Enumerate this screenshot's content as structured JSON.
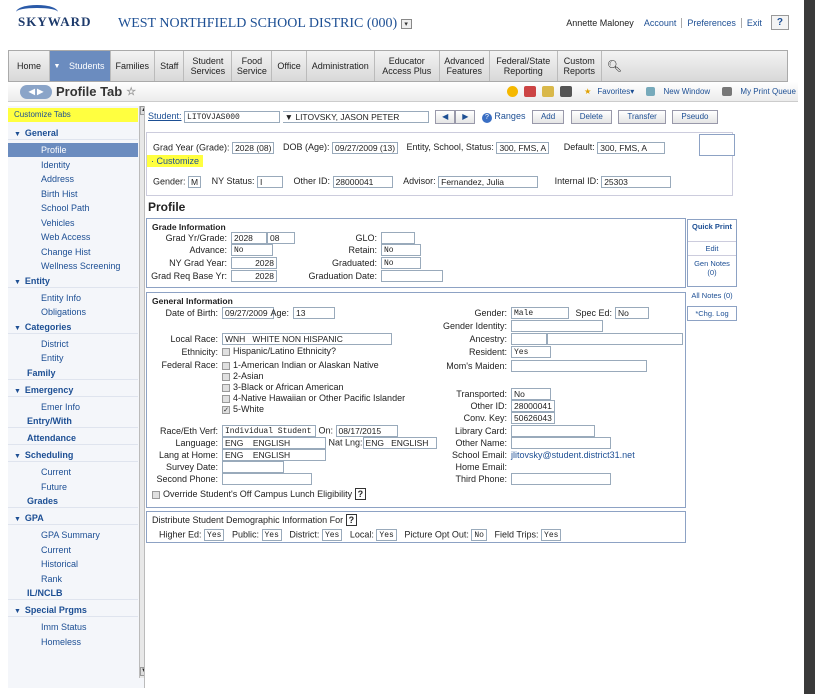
{
  "header": {
    "logo_text": "SKYWARD",
    "district_title": "WEST NORTHFIELD SCHOOL DISTRIC (000)",
    "user_name": "Annette Maloney",
    "links": [
      "Account",
      "Preferences",
      "Exit"
    ],
    "help": "?"
  },
  "nav": {
    "tabs": [
      "Home",
      "Students",
      "Families",
      "Staff",
      "Student Services",
      "Food Service",
      "Office",
      "Administration",
      "Educator Access Plus",
      "Advanced Features",
      "Federal/State Reporting",
      "Custom Reports"
    ]
  },
  "toolbar": {
    "title": "Profile Tab",
    "favorites": "Favorites",
    "new_window": "New Window",
    "print_queue": "My Print Queue"
  },
  "sidebar": {
    "customize_tabs": "Customize Tabs",
    "items": [
      {
        "label": "General",
        "type": "cat",
        "tri": true
      },
      {
        "label": "Profile",
        "type": "sub",
        "active": true
      },
      {
        "label": "Identity",
        "type": "sub"
      },
      {
        "label": "Address",
        "type": "sub"
      },
      {
        "label": "Birth Hist",
        "type": "sub"
      },
      {
        "label": "School Path",
        "type": "sub"
      },
      {
        "label": "Vehicles",
        "type": "sub"
      },
      {
        "label": "Web Access",
        "type": "sub"
      },
      {
        "label": "Change Hist",
        "type": "sub"
      },
      {
        "label": "Wellness Screening",
        "type": "sub"
      },
      {
        "label": "Entity",
        "type": "cat",
        "tri": true
      },
      {
        "label": "Entity Info",
        "type": "sub"
      },
      {
        "label": "Obligations",
        "type": "sub"
      },
      {
        "label": "Categories",
        "type": "cat",
        "tri": true
      },
      {
        "label": "District",
        "type": "sub"
      },
      {
        "label": "Entity",
        "type": "sub"
      },
      {
        "label": "Family",
        "type": "cat"
      },
      {
        "label": "Emergency",
        "type": "cat",
        "tri": true
      },
      {
        "label": "Emer Info",
        "type": "sub"
      },
      {
        "label": "Entry/With",
        "type": "cat"
      },
      {
        "label": "Attendance",
        "type": "cat"
      },
      {
        "label": "Scheduling",
        "type": "cat",
        "tri": true
      },
      {
        "label": "Current",
        "type": "sub"
      },
      {
        "label": "Future",
        "type": "sub"
      },
      {
        "label": "Grades",
        "type": "cat"
      },
      {
        "label": "GPA",
        "type": "cat",
        "tri": true
      },
      {
        "label": "GPA Summary",
        "type": "sub"
      },
      {
        "label": "Current",
        "type": "sub"
      },
      {
        "label": "Historical",
        "type": "sub"
      },
      {
        "label": "Rank",
        "type": "sub"
      },
      {
        "label": "IL/NCLB",
        "type": "cat"
      },
      {
        "label": "Special Prgms",
        "type": "cat",
        "tri": true
      },
      {
        "label": "Imm Status",
        "type": "sub"
      },
      {
        "label": "Homeless",
        "type": "sub"
      }
    ]
  },
  "student_bar": {
    "student_label": "Student:",
    "student_id": "LITOVJAS000",
    "student_name": "LITOVSKY, JASON PETER",
    "ranges": "Ranges",
    "buttons": [
      "Add",
      "Delete",
      "Transfer",
      "Pseudo"
    ]
  },
  "summary": {
    "grad_label": "Grad Year (Grade):",
    "grad_value": "2028 (08)",
    "dob_label": "DOB (Age):",
    "dob_value": "09/27/2009 (13)",
    "entity_label": "Entity, School, Status:",
    "entity_value": "300, FMS, A",
    "default_label": "Default:",
    "default_value": "300, FMS, A",
    "customize": "Customize",
    "gender_label": "Gender:",
    "gender_value": "M",
    "nystatus_label": "NY Status:",
    "nystatus_value": "I",
    "otherid_label": "Other ID:",
    "otherid_value": "28000041",
    "advisor_label": "Advisor:",
    "advisor_value": "Fernandez, Julia",
    "internalid_label": "Internal ID:",
    "internalid_value": "25303"
  },
  "profile": {
    "heading": "Profile",
    "grade_info": {
      "title": "Grade Information",
      "grad_yr_label": "Grad Yr/Grade:",
      "grad_yr": "2028",
      "grade": "08",
      "glo_label": "GLO:",
      "advance_label": "Advance:",
      "advance": "No",
      "retain_label": "Retain:",
      "retain": "No",
      "ny_grad_label": "NY Grad Year:",
      "ny_grad": "2028",
      "graduated_label": "Graduated:",
      "graduated": "No",
      "grad_req_label": "Grad Req Base Yr:",
      "grad_req": "2028",
      "grad_date_label": "Graduation Date:"
    },
    "general_info": {
      "title": "General Information",
      "dob_label": "Date of Birth:",
      "dob": "09/27/2009",
      "age_label": "Age:",
      "age": "13",
      "gender_label": "Gender:",
      "gender": "Male",
      "spec_ed_label": "Spec Ed:",
      "spec_ed": "No",
      "gender_identity_label": "Gender Identity:",
      "local_race_label": "Local Race:",
      "local_race_code": "WNH",
      "local_race_desc": "WHITE NON HISPANIC",
      "ancestry_label": "Ancestry:",
      "ethnicity_label": "Ethnicity:",
      "ethnicity_option": "Hispanic/Latino Ethnicity?",
      "resident_label": "Resident:",
      "resident": "Yes",
      "federal_race_label": "Federal Race:",
      "federal_races": [
        "1-American Indian or Alaskan Native",
        "2-Asian",
        "3-Black or African American",
        "4-Native Hawaiian or Other Pacific Islander",
        "5-White"
      ],
      "moms_maiden_label": "Mom's Maiden:",
      "transported_label": "Transported:",
      "transported": "No",
      "other_id_label": "Other ID:",
      "other_id": "28000041",
      "conv_key_label": "Conv. Key:",
      "conv_key": "50626043",
      "race_eth_label": "Race/Eth Verf:",
      "race_eth": "Individual Student",
      "on_label": "On:",
      "on_date": "08/17/2015",
      "library_card_label": "Library Card:",
      "language_label": "Language:",
      "language_code": "ENG",
      "language_desc": "ENGLISH",
      "nat_lng_label": "Nat Lng:",
      "nat_lng_code": "ENG",
      "nat_lng_desc": "ENGLISH",
      "other_name_label": "Other Name:",
      "lang_home_label": "Lang at Home:",
      "lang_home_code": "ENG",
      "lang_home_desc": "ENGLISH",
      "school_email_label": "School Email:",
      "school_email": "jlitovsky@student.district31.net",
      "survey_date_label": "Survey Date:",
      "home_email_label": "Home Email:",
      "second_phone_label": "Second Phone:",
      "third_phone_label": "Third Phone:",
      "override_label": "Override Student's Off Campus Lunch Eligibility"
    },
    "distribute": {
      "title": "Distribute Student Demographic Information For",
      "higher_ed_label": "Higher Ed:",
      "higher_ed": "Yes",
      "public_label": "Public:",
      "public": "Yes",
      "district_label": "District:",
      "district": "Yes",
      "local_label": "Local:",
      "local": "Yes",
      "picture_label": "Picture Opt Out:",
      "picture": "No",
      "field_trips_label": "Field Trips:",
      "field_trips": "Yes"
    }
  },
  "right_buttons": {
    "quick_print": "Quick Print",
    "edit": "Edit",
    "gen_notes": "Gen Notes (0)",
    "all_notes": "All Notes (0)",
    "chg_log": "*Chg. Log"
  },
  "colors": {
    "accent": "#6b8cbf",
    "link": "#1d4f94",
    "highlight": "#ffff40"
  }
}
